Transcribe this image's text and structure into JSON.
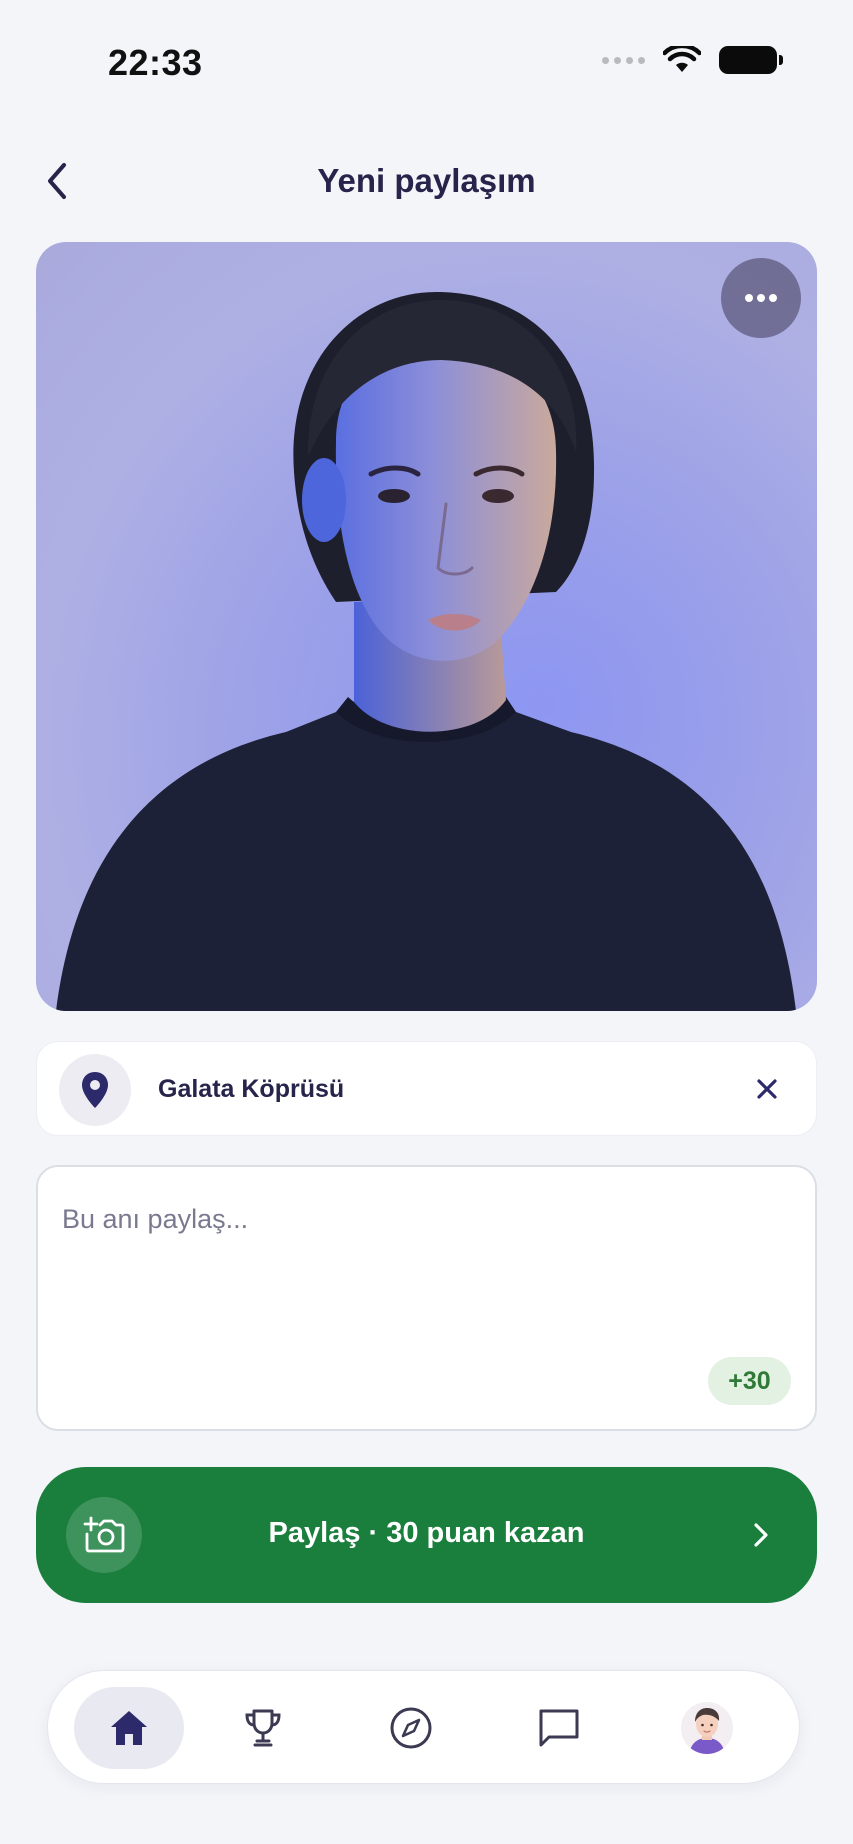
{
  "status_bar": {
    "time": "22:33"
  },
  "header": {
    "title": "Yeni paylaşım"
  },
  "location": {
    "name": "Galata Köprüsü"
  },
  "caption": {
    "placeholder": "Bu anı paylaş...",
    "value": "",
    "points_badge": "+30"
  },
  "share_button": {
    "label": "Paylaş · 30 puan kazan"
  },
  "bottom_nav": {
    "active": "home",
    "items": [
      "home",
      "trophy",
      "compass",
      "chat",
      "profile"
    ]
  },
  "colors": {
    "accent_dark": "#2c2a6b",
    "primary_green": "#1a7e3c",
    "badge_green_bg": "#e3f1e3",
    "badge_green_text": "#2f7a36"
  },
  "icons": [
    "back-chevron-icon",
    "more-dots-icon",
    "location-pin-icon",
    "close-icon",
    "camera-add-icon",
    "chevron-right-icon",
    "home-icon",
    "trophy-icon",
    "compass-icon",
    "chat-bubble-icon",
    "avatar"
  ]
}
